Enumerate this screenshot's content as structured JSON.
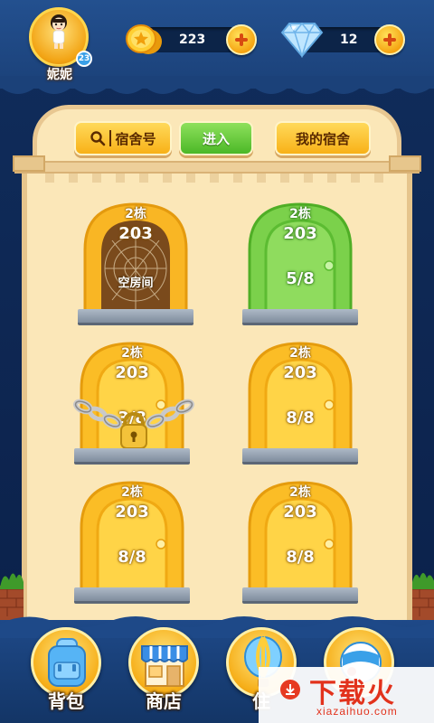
{
  "player": {
    "name": "妮妮",
    "level": "23"
  },
  "resources": {
    "coins": {
      "value": "223",
      "icon": "coin-icon"
    },
    "diamonds": {
      "value": "12",
      "icon": "diamond-icon"
    }
  },
  "toolbar": {
    "search_label": "宿舍号",
    "enter_label": "进入",
    "my_dorm_label": "我的宿舍"
  },
  "doors": [
    {
      "building": "2栋",
      "room": "203",
      "status": "空房间",
      "style": "web",
      "locked": false
    },
    {
      "building": "2栋",
      "room": "203",
      "occupancy": "5/8",
      "style": "green",
      "locked": false
    },
    {
      "building": "2栋",
      "room": "203",
      "occupancy": "3/8",
      "style": "gold",
      "locked": true
    },
    {
      "building": "2栋",
      "room": "203",
      "occupancy": "8/8",
      "style": "gold",
      "locked": false
    },
    {
      "building": "2栋",
      "room": "203",
      "occupancy": "8/8",
      "style": "gold",
      "locked": false
    },
    {
      "building": "2栋",
      "room": "203",
      "occupancy": "8/8",
      "style": "gold",
      "locked": false
    }
  ],
  "nav": [
    {
      "label": "背包",
      "icon": "backpack-icon"
    },
    {
      "label": "商店",
      "icon": "shop-icon"
    },
    {
      "label": "住",
      "icon": "balloon-icon"
    },
    {
      "label": "",
      "icon": "ball-icon"
    }
  ],
  "watermark": {
    "main": "下载火",
    "sub": "xiazaihuo.com"
  },
  "colors": {
    "gold": "#f8b117",
    "green": "#5cc22e",
    "panel": "#fbe7b8",
    "navy": "#0f2a55"
  }
}
